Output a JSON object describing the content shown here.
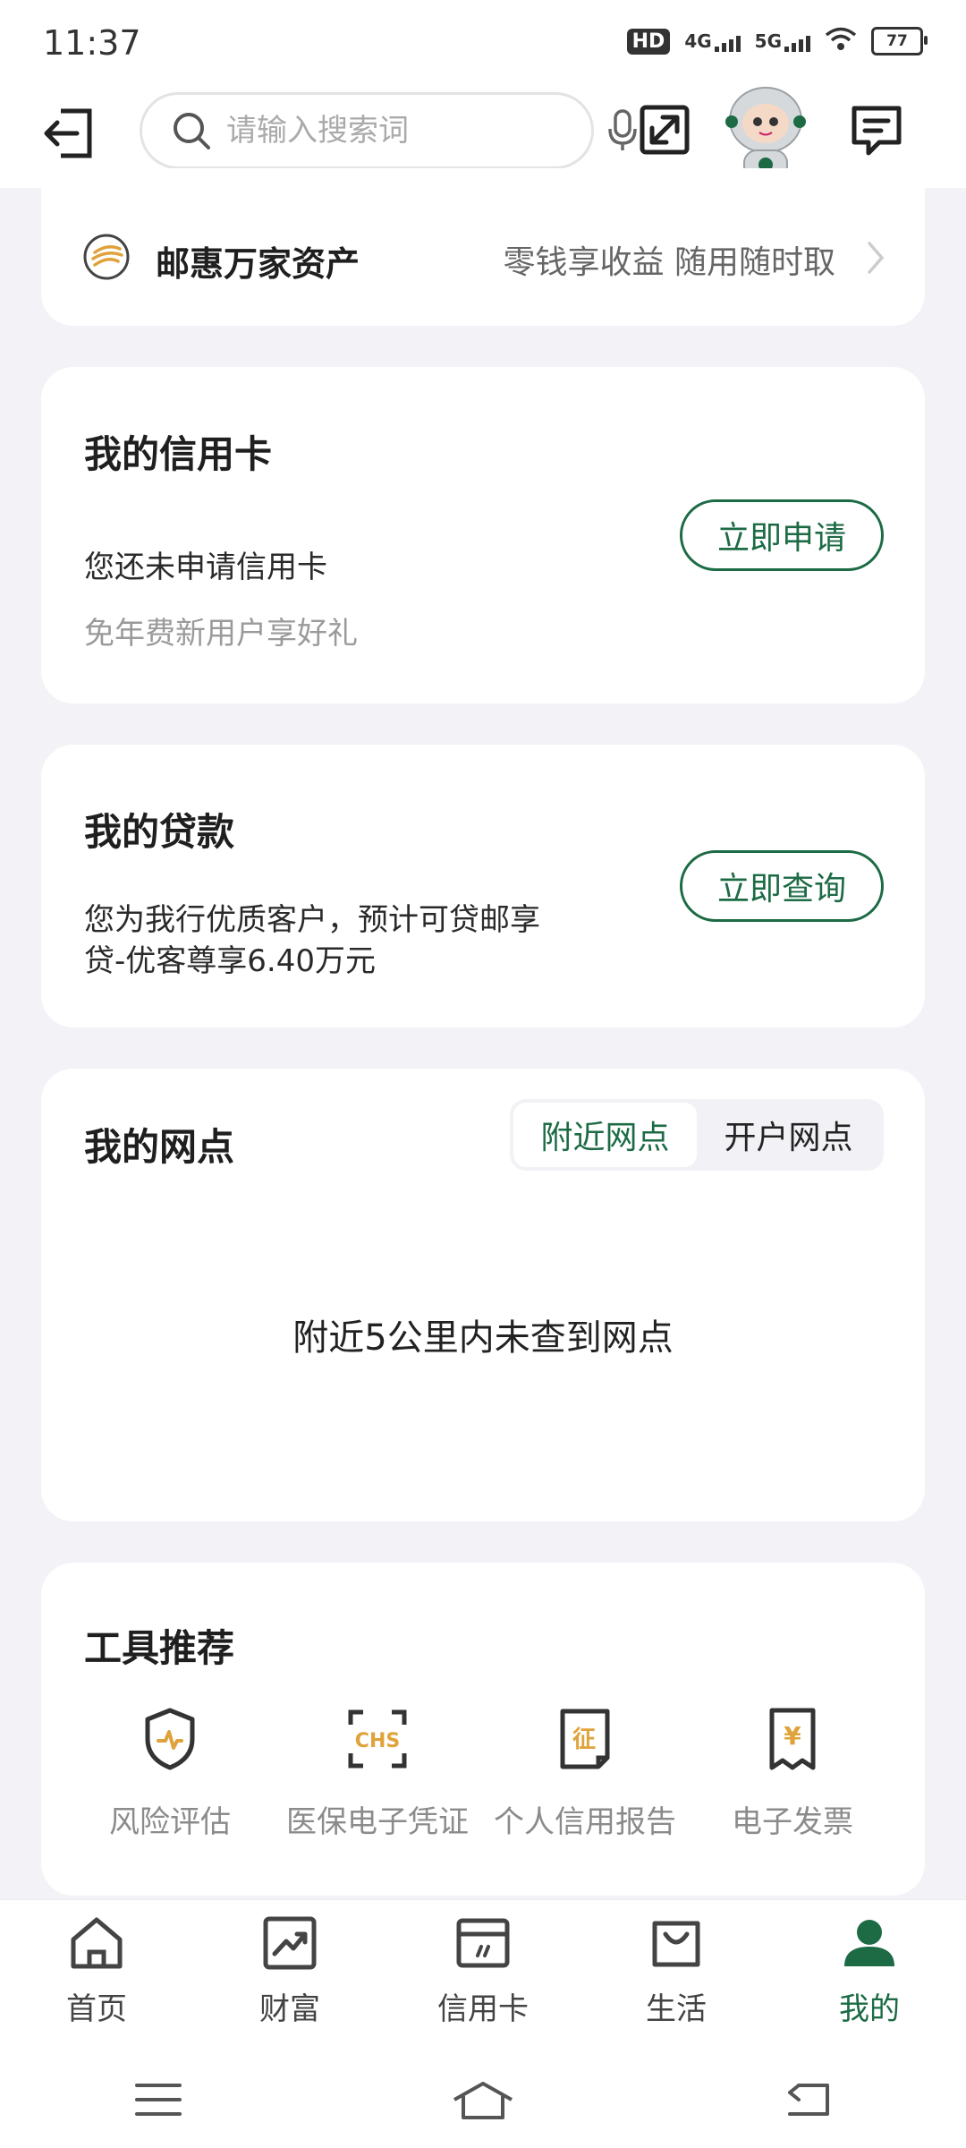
{
  "status_bar": {
    "time": "11:37",
    "hd": "HD",
    "net1": "4G",
    "net2": "5G",
    "battery": "77"
  },
  "header": {
    "search_placeholder": "请输入搜索词"
  },
  "asset_card": {
    "title": "邮惠万家资产",
    "subtitle": "零钱享收益 随用随时取"
  },
  "credit_card": {
    "title": "我的信用卡",
    "status": "您还未申请信用卡",
    "promo": "免年费新用户享好礼",
    "button": "立即申请"
  },
  "loan": {
    "title": "我的贷款",
    "line1": "您为我行优质客户，预计可贷邮享",
    "line2": "贷-优客尊享6.40万元",
    "button": "立即查询"
  },
  "branch": {
    "title": "我的网点",
    "tab_nearby": "附近网点",
    "tab_account": "开户网点",
    "empty": "附近5公里内未查到网点"
  },
  "tools": {
    "title": "工具推荐",
    "items": [
      {
        "label": "风险评估",
        "icon": "shield-icon"
      },
      {
        "label": "医保电子凭证",
        "icon": "chs-icon",
        "icon_text": "CHS"
      },
      {
        "label": "个人信用报告",
        "icon": "credit-report-icon",
        "icon_text": "征"
      },
      {
        "label": "电子发票",
        "icon": "invoice-icon",
        "icon_text": "¥"
      }
    ]
  },
  "tabbar": [
    {
      "label": "首页",
      "icon": "home-icon"
    },
    {
      "label": "财富",
      "icon": "wealth-icon"
    },
    {
      "label": "信用卡",
      "icon": "credit-card-icon"
    },
    {
      "label": "生活",
      "icon": "shopping-bag-icon"
    },
    {
      "label": "我的",
      "icon": "user-icon",
      "active": true
    }
  ],
  "colors": {
    "accent": "#1c6b45",
    "tool_orange": "#e0a23a",
    "background": "#f3f3f7"
  }
}
